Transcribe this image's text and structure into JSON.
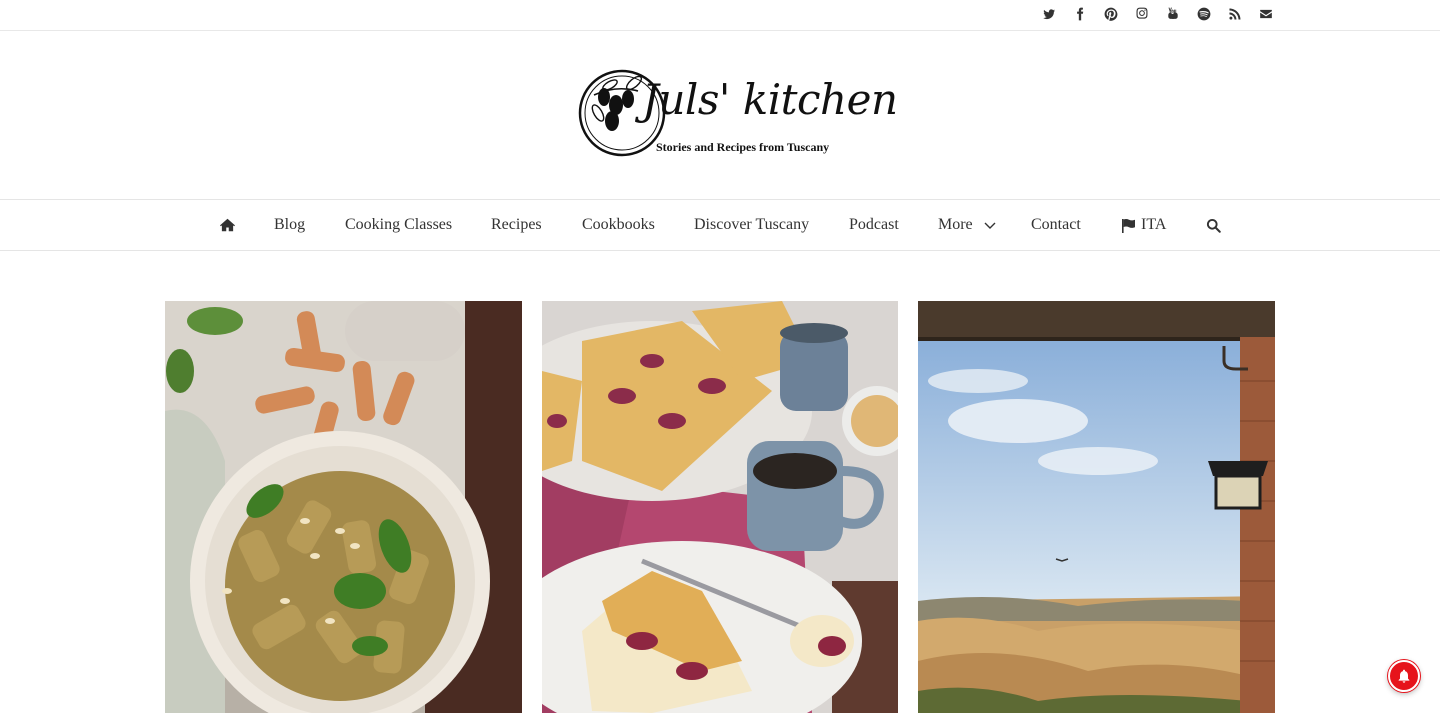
{
  "social": [
    "twitter-icon",
    "facebook-icon",
    "pinterest-icon",
    "instagram-icon",
    "youtube-icon",
    "spotify-icon",
    "rss-icon",
    "email-icon"
  ],
  "brand": {
    "title": "Juls' kitchen",
    "tagline": "Stories and Recipes from Tuscany"
  },
  "nav": {
    "home_icon": "home-icon",
    "items": [
      "Blog",
      "Cooking Classes",
      "Recipes",
      "Cookbooks",
      "Discover Tuscany",
      "Podcast",
      "More",
      "Contact",
      "ITA"
    ],
    "search_icon": "search-icon"
  },
  "featured": [
    {
      "subject": "pesto rigatoni bowl"
    },
    {
      "subject": "plum crumble cake with coffee"
    },
    {
      "subject": "tuscan countryside view"
    }
  ],
  "colors": {
    "accent": "#e6141c",
    "text": "#333333"
  }
}
